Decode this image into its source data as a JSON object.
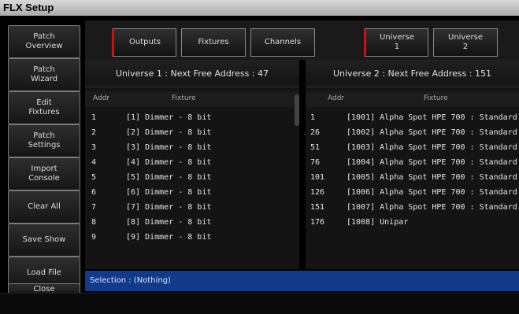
{
  "window": {
    "title": "FLX Setup"
  },
  "sidebar": {
    "items": [
      {
        "label": "Patch\nOverview",
        "active": true
      },
      {
        "label": "Patch\nWizard",
        "active": false
      },
      {
        "label": "Edit\nFixtures",
        "active": false
      },
      {
        "label": "Patch\nSettings",
        "active": false
      },
      {
        "label": "Import\nConsole",
        "active": false
      },
      {
        "label": "Clear All",
        "active": false
      },
      {
        "label": "Save Show",
        "active": false
      },
      {
        "label": "Load File",
        "active": false
      },
      {
        "label": "Close",
        "active": false
      }
    ]
  },
  "tabs": [
    {
      "label": "Outputs",
      "active": true
    },
    {
      "label": "Fixtures",
      "active": false
    },
    {
      "label": "Channels",
      "active": false
    },
    {
      "label": "Universe\n1",
      "active": true
    },
    {
      "label": "Universe\n2",
      "active": false
    }
  ],
  "left_panel": {
    "title": "Universe 1 : Next Free Address : 47",
    "columns": [
      "Addr",
      "Fixture"
    ],
    "rows": [
      {
        "addr": "1",
        "fixture": "[1] Dimmer - 8 bit"
      },
      {
        "addr": "2",
        "fixture": "[2] Dimmer - 8 bit"
      },
      {
        "addr": "3",
        "fixture": "[3] Dimmer - 8 bit"
      },
      {
        "addr": "4",
        "fixture": "[4] Dimmer - 8 bit"
      },
      {
        "addr": "5",
        "fixture": "[5] Dimmer - 8 bit"
      },
      {
        "addr": "6",
        "fixture": "[6] Dimmer - 8 bit"
      },
      {
        "addr": "7",
        "fixture": "[7] Dimmer - 8 bit"
      },
      {
        "addr": "8",
        "fixture": "[8] Dimmer - 8 bit"
      },
      {
        "addr": "9",
        "fixture": "[9] Dimmer - 8 bit"
      }
    ]
  },
  "right_panel": {
    "title": "Universe 2 : Next Free Address : 151",
    "columns": [
      "Addr",
      "Fixture"
    ],
    "rows": [
      {
        "addr": "1",
        "fixture": "[1001] Alpha Spot HPE 700 : Standard"
      },
      {
        "addr": "26",
        "fixture": "[1002] Alpha Spot HPE 700 : Standard"
      },
      {
        "addr": "51",
        "fixture": "[1003] Alpha Spot HPE 700 : Standard"
      },
      {
        "addr": "76",
        "fixture": "[1004] Alpha Spot HPE 700 : Standard"
      },
      {
        "addr": "101",
        "fixture": "[1005] Alpha Spot HPE 700 : Standard"
      },
      {
        "addr": "126",
        "fixture": "[1006] Alpha Spot HPE 700 : Standard"
      },
      {
        "addr": "151",
        "fixture": "[1007] Alpha Spot HPE 700 : Standard"
      },
      {
        "addr": "176",
        "fixture": "[1008] Unipar"
      }
    ]
  },
  "status": {
    "text": "Selection :   (Nothing)"
  },
  "colors": {
    "accent": "#d01010",
    "status_bg": "#123a8a"
  }
}
